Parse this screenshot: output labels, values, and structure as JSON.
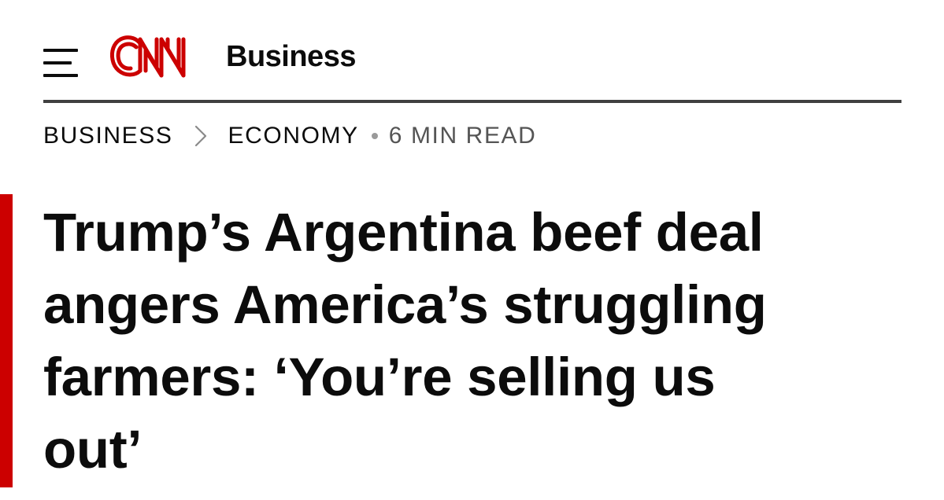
{
  "header": {
    "menu_icon": "hamburger-menu-icon",
    "logo_text": "CNN",
    "section": "Business",
    "brand_color": "#CC0000"
  },
  "breadcrumb": {
    "items": [
      "BUSINESS",
      "ECONOMY"
    ],
    "separator_icon": "chevron-right-icon",
    "read_time": "6 MIN READ"
  },
  "article": {
    "headline_lines": [
      "Trump’s Argentina beef deal",
      "angers America’s struggling",
      "farmers: ‘You’re selling us",
      "out’"
    ],
    "accent_color": "#CC0000"
  }
}
